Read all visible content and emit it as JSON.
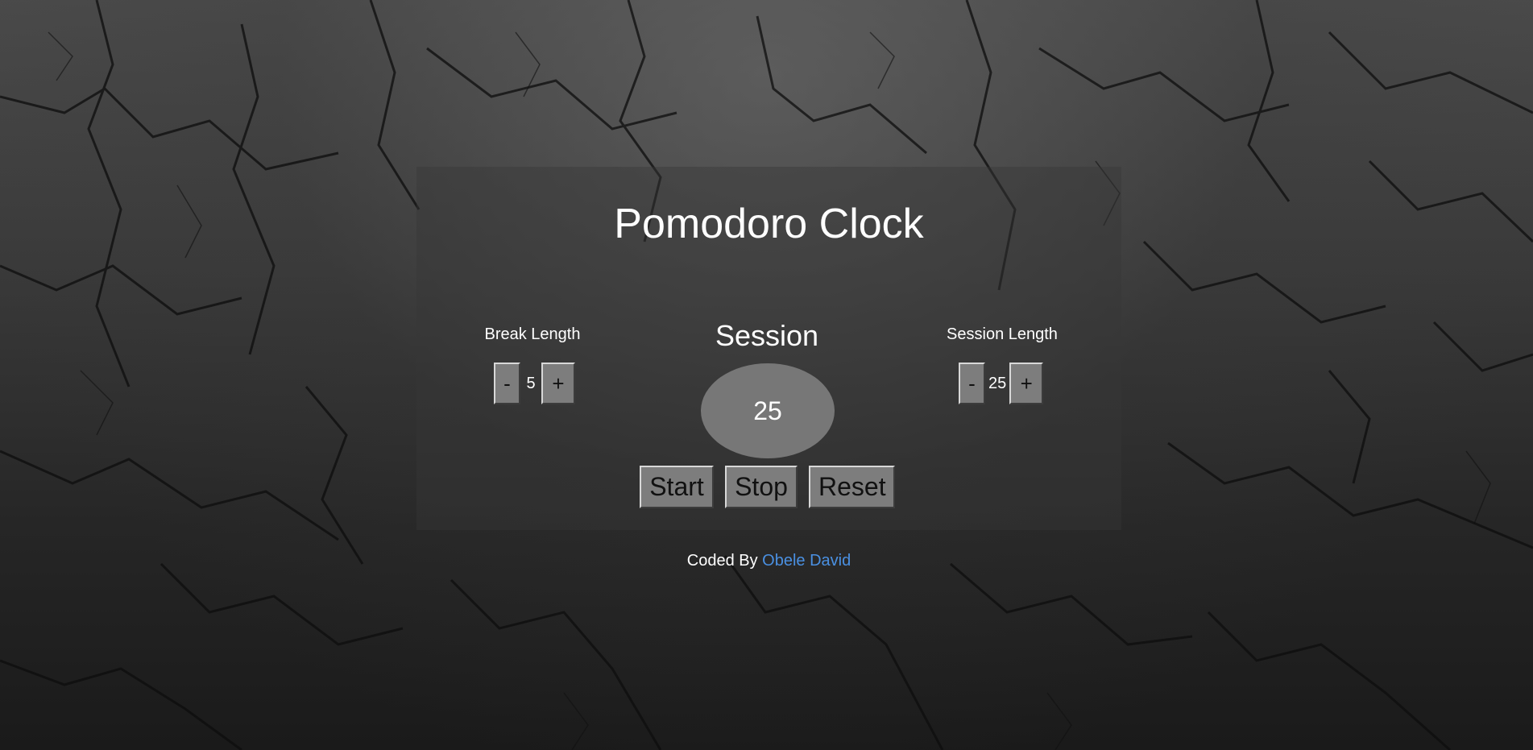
{
  "app": {
    "title": "Pomodoro Clock"
  },
  "break_control": {
    "label": "Break Length",
    "decrement_label": "-",
    "value": "5",
    "increment_label": "+"
  },
  "session_control": {
    "label": "Session Length",
    "decrement_label": "-",
    "value": "25",
    "increment_label": "+"
  },
  "timer": {
    "mode": "Session",
    "display": "25"
  },
  "controls": {
    "start_label": "Start",
    "stop_label": "Stop",
    "reset_label": "Reset"
  },
  "footer": {
    "prefix": "Coded By",
    "author_link": "Obele David"
  },
  "colors": {
    "link": "#4a90e2",
    "button": "#7d7d7d",
    "timer_circle": "#777777"
  }
}
